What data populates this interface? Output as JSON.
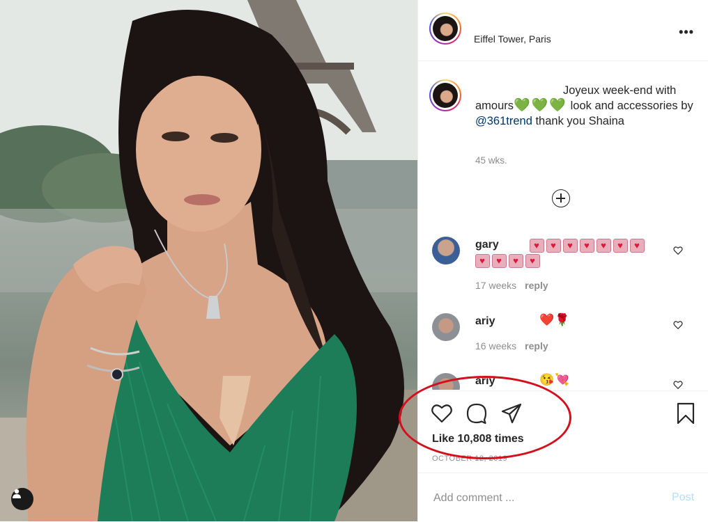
{
  "post": {
    "location": "Eiffel Tower, Paris",
    "caption_text": "Joyeux week-end with amours",
    "caption_emoji": "💚💚💚",
    "caption_after": " look and accessories by ",
    "caption_mention": "@361trend",
    "caption_end": " thank you Shaina",
    "time_ago": "45 wks.",
    "likes_text": "Like 10,808 times",
    "date_text": "OCTOBER 12, 2019"
  },
  "comments": [
    {
      "user": "gary",
      "emoji_line1": "♥♥♥♥♥♥♥",
      "emoji_line2": "♥♥♥♥",
      "time": "17 weeks",
      "reply": "reply"
    },
    {
      "user": "ariy",
      "emoji": "❤️🌹",
      "time": "16 weeks",
      "reply": "reply"
    },
    {
      "user": "ariy",
      "emoji": "😘💘"
    }
  ],
  "composer": {
    "placeholder": "Add comment ...",
    "post_label": "Post"
  },
  "colors": {
    "text": "#262626",
    "muted": "#8e8e8e",
    "mention": "#00376b",
    "post_button": "#b2dffc",
    "annotation": "#d40f1b",
    "green_hearts": "#2fbf2f"
  },
  "icons": [
    "more-icon",
    "plus-circle-icon",
    "heart-icon",
    "comment-icon",
    "share-icon",
    "bookmark-icon",
    "user-tag-icon"
  ]
}
